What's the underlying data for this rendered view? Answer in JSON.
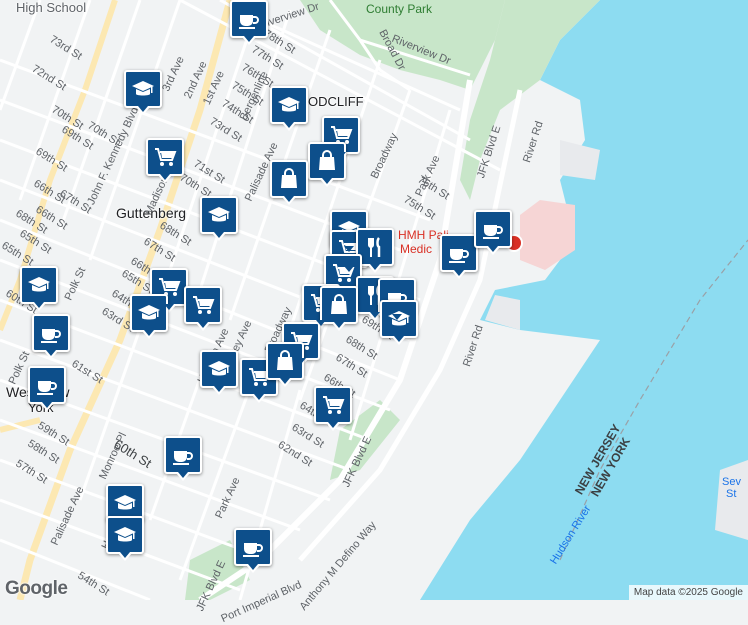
{
  "map": {
    "places": {
      "guttenberg": "Guttenberg",
      "woodcliff": "ODCLIFF",
      "west_new_york_1": "West New",
      "west_new_york_2": "York",
      "high_school": "High School",
      "county_park": "County Park"
    },
    "hospital": {
      "line1": "HMH Pali",
      "line2": "Medic"
    },
    "water": {
      "hudson_river": "Hudson River"
    },
    "state_border": {
      "nj": "NEW JERSEY",
      "ny": "NEW YORK"
    },
    "streets": {
      "s1": "73rd St",
      "s2": "72nd St",
      "s3": "John F. Kennedy Blvd",
      "s4": "70th St",
      "s5": "70th St",
      "s6": "69th St",
      "s7": "67th St",
      "s8": "66th St",
      "s9": "65th St",
      "s10": "Polk St",
      "s11": "Polk St",
      "s12": "61st St",
      "s13": "60th St",
      "s14": "59th St",
      "s15": "58th St",
      "s16": "57th St",
      "s17": "Monroe Pl",
      "s18": "Palisade Ave",
      "s19": "Hudson Ave",
      "s20": "Hudson Ave",
      "s21": "Dewey Ave",
      "s22": "Broadway",
      "s23": "Broadway",
      "s24": "Bergenline",
      "s25": "3rd Ave",
      "s26": "2nd Ave",
      "s27": "1st Ave",
      "s28": "Madison Ave",
      "s29": "Palisade Ave",
      "s30": "71st St",
      "s31": "70th St",
      "s32": "74th St",
      "s33": "73rd St",
      "s34": "75th St",
      "s35": "76th St",
      "s36": "77th St",
      "s37": "78th St",
      "s38": "Riverview Dr",
      "s39": "Riverview Dr",
      "s40": "Broad Dr",
      "s41": "Park Ave",
      "s42": "Park Ave",
      "s43": "76th St",
      "s44": "75th St",
      "s45": "JFK Blvd E",
      "s46": "JFK Blvd E",
      "s47": "River Rd",
      "s48": "River Rd",
      "s49": "69th St",
      "s50": "68th St",
      "s51": "67th St",
      "s52": "66th St",
      "s53": "64th St",
      "s54": "63rd St",
      "s55": "62nd St",
      "s56": "Anthony M Defino Way",
      "s57": "Port Imperial Blvd",
      "s58": "JFK Blvd E",
      "s59": "54th St",
      "s60": "68th St",
      "s61": "67th St",
      "s62": "66th",
      "s63": "65th St",
      "s64": "64th St",
      "s65": "63rd St",
      "s66": "60th St",
      "s67": "68th St",
      "s68": "65th St",
      "s69": "66th St",
      "s70": "69th St",
      "s71": "Sev",
      "s72": "St"
    },
    "markers": [
      {
        "type": "cafe",
        "name": "cafe-marker"
      },
      {
        "type": "school",
        "name": "school-marker"
      },
      {
        "type": "school",
        "name": "school-marker"
      },
      {
        "type": "grocery",
        "name": "grocery-marker"
      },
      {
        "type": "grocery",
        "name": "grocery-marker"
      },
      {
        "type": "shopping",
        "name": "shopping-marker"
      },
      {
        "type": "shopping",
        "name": "shopping-marker"
      },
      {
        "type": "school",
        "name": "school-marker"
      },
      {
        "type": "school",
        "name": "school-marker"
      },
      {
        "type": "grocery",
        "name": "grocery-marker"
      },
      {
        "type": "school",
        "name": "school-marker"
      },
      {
        "type": "grocery",
        "name": "grocery-marker"
      },
      {
        "type": "cafe",
        "name": "cafe-marker"
      },
      {
        "type": "cafe",
        "name": "cafe-marker"
      },
      {
        "type": "restaurant",
        "name": "restaurant-marker"
      },
      {
        "type": "grocery",
        "name": "grocery-marker"
      },
      {
        "type": "grocery",
        "name": "grocery-marker"
      },
      {
        "type": "restaurant",
        "name": "restaurant-marker"
      },
      {
        "type": "cafe",
        "name": "cafe-marker"
      },
      {
        "type": "school",
        "name": "school-marker"
      },
      {
        "type": "grocery",
        "name": "grocery-marker"
      },
      {
        "type": "shopping",
        "name": "shopping-marker"
      },
      {
        "type": "school",
        "name": "school-marker"
      },
      {
        "type": "grocery",
        "name": "grocery-marker"
      },
      {
        "type": "grocery",
        "name": "grocery-marker"
      },
      {
        "type": "cafe",
        "name": "cafe-marker"
      },
      {
        "type": "school",
        "name": "school-marker"
      },
      {
        "type": "school",
        "name": "school-marker"
      },
      {
        "type": "cafe",
        "name": "cafe-marker"
      },
      {
        "type": "cafe",
        "name": "cafe-marker"
      },
      {
        "type": "cafe",
        "name": "cafe-marker"
      }
    ],
    "brand": "Google",
    "attribution": "Map data ©2025 Google"
  }
}
